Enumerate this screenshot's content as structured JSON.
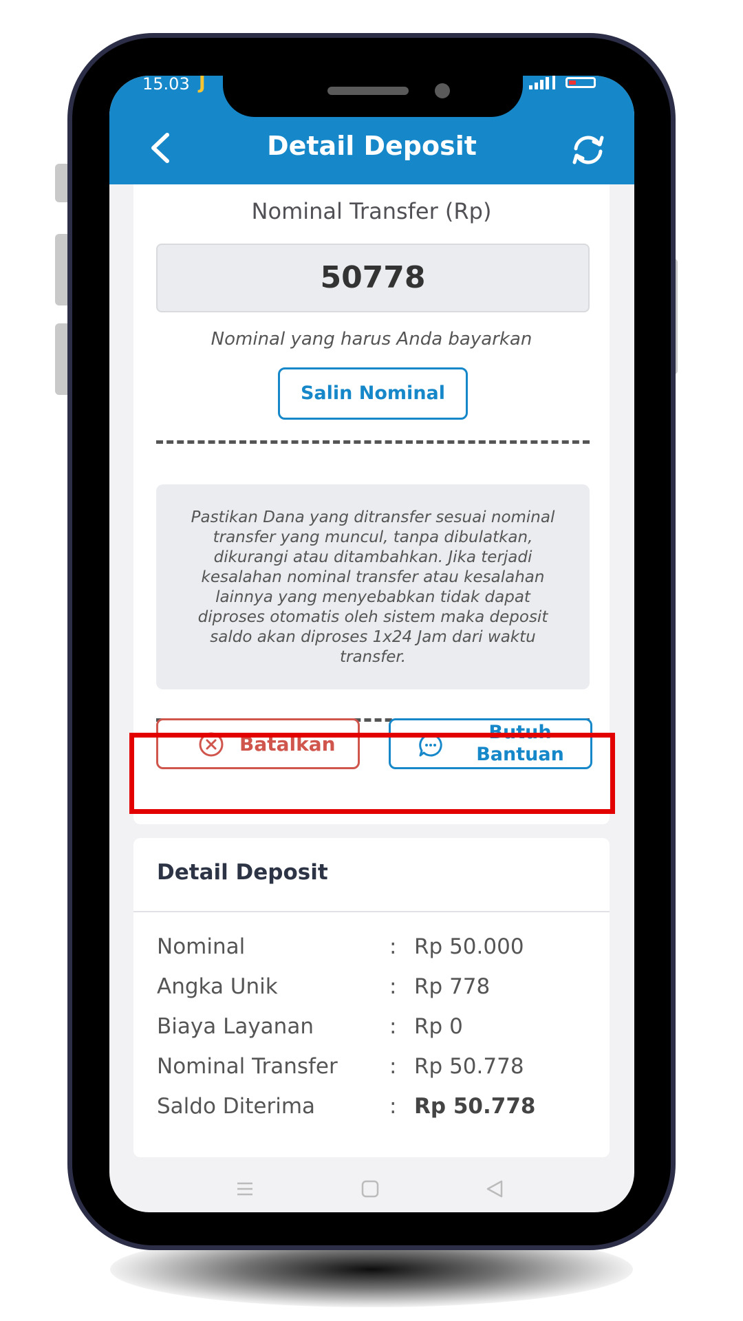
{
  "status_bar": {
    "time": "15.03",
    "app_icon": "J"
  },
  "header": {
    "title": "Detail Deposit",
    "back_icon": "chevron-left-icon",
    "refresh_icon": "refresh-icon"
  },
  "transfer": {
    "label": "Nominal Transfer (Rp)",
    "amount": "50778",
    "hint": "Nominal yang harus Anda bayarkan",
    "copy_button": "Salin Nominal"
  },
  "notice": {
    "lines": [
      "Pastikan Dana yang ditransfer sesuai nominal",
      "transfer yang muncul, tanpa dibulatkan,",
      "dikurangi atau ditambahkan. Jika terjadi",
      "kesalahan nominal transfer atau kesalahan",
      "lainnya yang menyebabkan tidak dapat",
      "diproses otomatis oleh sistem maka deposit",
      "saldo akan diproses 1x24 Jam dari waktu",
      "transfer."
    ]
  },
  "actions": {
    "cancel_label": "Batalkan",
    "help_label_line1": "Butuh",
    "help_label_line2": "Bantuan"
  },
  "detail": {
    "title": "Detail Deposit",
    "rows": [
      {
        "key": "Nominal",
        "sep": ":",
        "value": "Rp 50.000"
      },
      {
        "key": "Angka Unik",
        "sep": ":",
        "value": "Rp 778"
      },
      {
        "key": "Biaya Layanan",
        "sep": ":",
        "value": "Rp 0"
      },
      {
        "key": "Nominal Transfer",
        "sep": ":",
        "value": "Rp 50.778"
      },
      {
        "key": "Saldo Diterima",
        "sep": ":",
        "value": "Rp 50.778"
      }
    ]
  },
  "colors": {
    "brand": "#1688c9",
    "danger": "#d0564d",
    "highlight": "#e30000"
  }
}
